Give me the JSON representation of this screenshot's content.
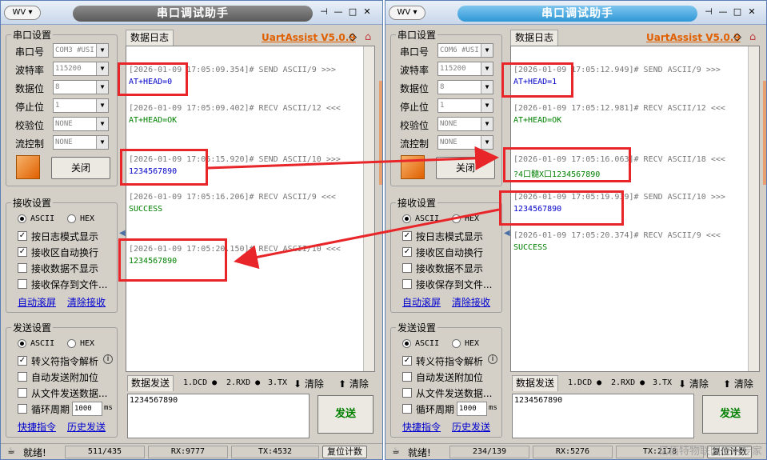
{
  "app": {
    "title": "串口调试助手",
    "brand": "UartAssist V5.0.9",
    "sys_icon": "WV ▾"
  },
  "labels": {
    "port_group": "串口设置",
    "port": "串口号",
    "baud": "波特率",
    "databits": "数据位",
    "stopbits": "停止位",
    "parity": "校验位",
    "flow": "流控制",
    "close_btn": "关闭",
    "recv_group": "接收设置",
    "ascii": "ASCII",
    "hex": "HEX",
    "recv_log_mode": "按日志模式显示",
    "recv_autowrap": "接收区自动换行",
    "recv_hide": "接收数据不显示",
    "recv_save": "接收保存到文件...",
    "auto_scroll": "自动滚屏",
    "clear_recv": "清除接收",
    "send_group": "发送设置",
    "escape": "转义符指令解析",
    "auto_append": "自动发送附加位",
    "from_file": "从文件发送数据...",
    "loop": "循环周期",
    "loop_unit": "ms",
    "shortcut": "快捷指令",
    "history": "历史发送",
    "data_log_tab": "数据日志",
    "data_send_tab": "数据发送",
    "dcd": "1.DCD",
    "rxd": "2.RXD",
    "txd": "3.TX",
    "clear": "清除",
    "send_btn": "发送",
    "reset_count": "复位计数",
    "ready": "就绪!"
  },
  "window1": {
    "port": "COM3 #USI",
    "baud": "115200",
    "databits": "8",
    "stopbits": "1",
    "parity": "NONE",
    "flow": "NONE",
    "loop_ms": "1000",
    "send_text": "1234567890",
    "log": [
      {
        "head": "[2026-01-09 17:05:09.354]# SEND ASCII/9 >>>",
        "body": "AT+HEAD=0",
        "dir": "tx"
      },
      {
        "head": "[2026-01-09 17:05:09.402]# RECV ASCII/12 <<<",
        "body": "AT+HEAD=OK",
        "dir": "rx"
      },
      {
        "head": "[2026-01-09 17:05:15.920]# SEND ASCII/10 >>>",
        "body": "1234567890",
        "dir": "tx"
      },
      {
        "head": "[2026-01-09 17:05:16.206]# RECV ASCII/9 <<<",
        "body": "SUCCESS",
        "dir": "rx"
      },
      {
        "head": "[2026-01-09 17:05:20.150]# RECV ASCII/10 <<<",
        "body": "1234567890",
        "dir": "rx"
      }
    ],
    "status": {
      "counter": "511/435",
      "rx": "RX:9777",
      "tx": "TX:4532"
    }
  },
  "window2": {
    "port": "COM6 #USI",
    "baud": "115200",
    "databits": "8",
    "stopbits": "1",
    "parity": "NONE",
    "flow": "NONE",
    "loop_ms": "1000",
    "send_text": "1234567890",
    "log": [
      {
        "head": "[2026-01-09 17:05:12.949]# SEND ASCII/9 >>>",
        "body": "AT+HEAD=1",
        "dir": "tx"
      },
      {
        "head": "[2026-01-09 17:05:12.981]# RECV ASCII/12 <<<",
        "body": "AT+HEAD=OK",
        "dir": "rx"
      },
      {
        "head": "[2026-01-09 17:05:16.063]# RECV ASCII/18 <<<",
        "body": "?4口髓X口1234567890",
        "dir": "rx"
      },
      {
        "head": "[2026-01-09 17:05:19.939]# SEND ASCII/10 >>>",
        "body": "1234567890",
        "dir": "tx"
      },
      {
        "head": "[2026-01-09 17:05:20.374]# RECV ASCII/9 <<<",
        "body": "SUCCESS",
        "dir": "rx"
      }
    ],
    "status": {
      "counter": "234/139",
      "rx": "RX:5276",
      "tx": "TX:2178"
    }
  },
  "watermark": "亿佰特物联网应用专家",
  "colors": {
    "highlight": "#e8262a",
    "tx_text": "#0000c8",
    "rx_text": "#008000",
    "brand": "#e06000"
  }
}
